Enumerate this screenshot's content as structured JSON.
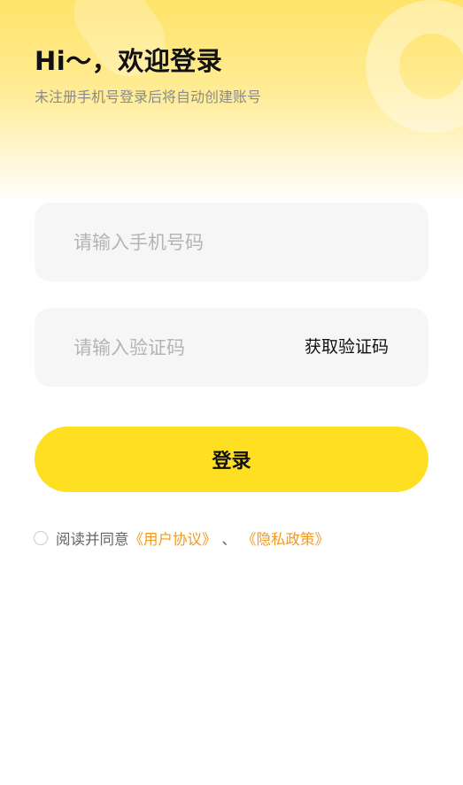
{
  "header": {
    "greeting": "Hi～，欢迎登录",
    "subtitle": "未注册手机号登录后将自动创建账号"
  },
  "form": {
    "phone_placeholder": "请输入手机号码",
    "code_placeholder": "请输入验证码",
    "get_code_label": "获取验证码",
    "login_label": "登录"
  },
  "agreement": {
    "prefix": "阅读并同意",
    "user_agreement": "《用户协议》",
    "separator": "、",
    "privacy_policy": "《隐私政策》",
    "checked": false
  },
  "colors": {
    "accent": "#ffdf22",
    "link": "#f39a1c",
    "input_bg": "#f6f6f6"
  }
}
